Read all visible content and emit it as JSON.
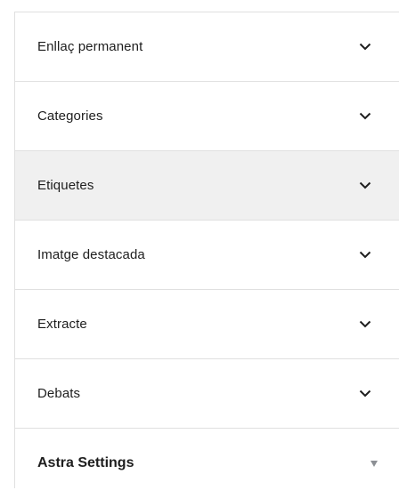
{
  "panels": [
    {
      "label": "Enllaç permanent",
      "icon": "chevron-down-icon"
    },
    {
      "label": "Categories",
      "icon": "chevron-down-icon"
    },
    {
      "label": "Etiquetes",
      "icon": "chevron-down-icon",
      "hovered": true
    },
    {
      "label": "Imatge destacada",
      "icon": "chevron-down-icon"
    },
    {
      "label": "Extracte",
      "icon": "chevron-down-icon"
    },
    {
      "label": "Debats",
      "icon": "chevron-down-icon"
    }
  ],
  "astra": {
    "label": "Astra Settings",
    "icon": "caret-down-icon"
  },
  "colors": {
    "border": "#e0e0e0",
    "hover_bg": "#f0f0f0",
    "text": "#1e1e1e",
    "caret": "#8c8f94"
  }
}
